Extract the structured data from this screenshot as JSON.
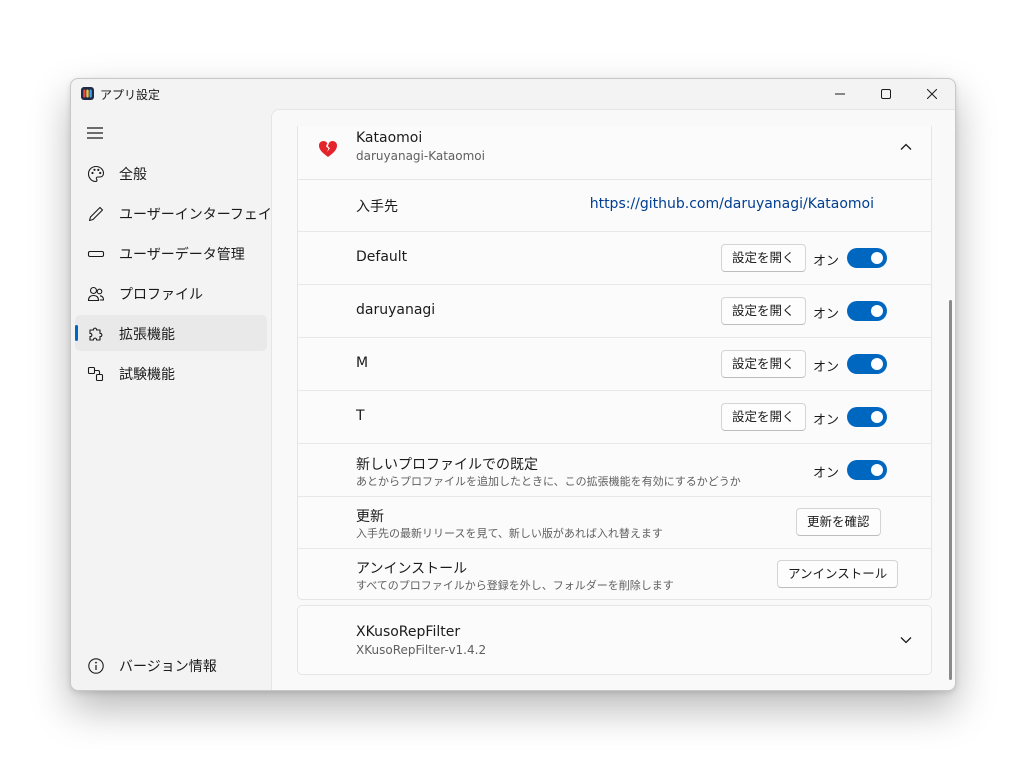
{
  "window": {
    "title": "アプリ設定"
  },
  "nav": {
    "items": [
      {
        "label": "全般",
        "icon": "palette-icon",
        "selected": false
      },
      {
        "label": "ユーザーインターフェイス",
        "icon": "pen-icon",
        "selected": false
      },
      {
        "label": "ユーザーデータ管理",
        "icon": "storage-icon",
        "selected": false
      },
      {
        "label": "プロファイル",
        "icon": "people-icon",
        "selected": false
      },
      {
        "label": "拡張機能",
        "icon": "puzzle-icon",
        "selected": true
      },
      {
        "label": "試験機能",
        "icon": "experiment-icon",
        "selected": false
      }
    ],
    "footer": {
      "label": "バージョン情報",
      "icon": "info-icon"
    }
  },
  "extension": {
    "name": "Kataomoi",
    "id": "daruyanagi-Kataomoi",
    "icon": "broken-heart-icon",
    "source_label": "入手先",
    "source_url": "https://github.com/daruyanagi/Kataomoi",
    "open_settings_label": "設定を開く",
    "on_label": "オン",
    "profiles": [
      {
        "name": "Default",
        "enabled": true
      },
      {
        "name": "daruyanagi",
        "enabled": true
      },
      {
        "name": "M",
        "enabled": true
      },
      {
        "name": "T",
        "enabled": true
      }
    ],
    "default_new_profile": {
      "title": "新しいプロファイルでの既定",
      "description": "あとからプロファイルを追加したときに、この拡張機能を有効にするかどうか"
    },
    "update": {
      "title": "更新",
      "description": "入手先の最新リリースを見て、新しい版があれば入れ替えます",
      "button": "更新を確認"
    },
    "uninstall": {
      "title": "アンインストール",
      "description": "すべてのプロファイルから登録を外し、フォルダーを削除します",
      "button": "アンインストール"
    }
  },
  "extension2": {
    "name": "XKusoRepFilter",
    "id": "XKusoRepFilter-v1.4.2"
  },
  "colors": {
    "accent": "#0067c0",
    "link": "#003e92",
    "heart": "#e3242b"
  }
}
